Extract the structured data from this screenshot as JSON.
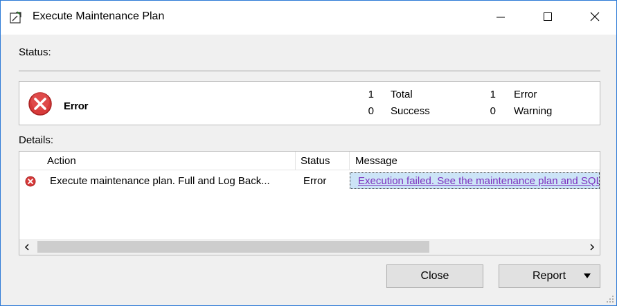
{
  "window": {
    "title": "Execute Maintenance Plan",
    "accent_color": "#2b79d6",
    "icons": [
      "maintenance-plan-icon",
      "minimize-icon",
      "maximize-icon",
      "close-icon"
    ]
  },
  "status": {
    "label": "Status:",
    "state": "Error",
    "state_icon": "error-icon",
    "error_color": "#d73a3a",
    "total_count": "1",
    "total_label": "Total",
    "success_count": "0",
    "success_label": "Success",
    "error_count": "1",
    "error_label": "Error",
    "warning_count": "0",
    "warning_label": "Warning"
  },
  "details": {
    "label": "Details:",
    "columns": [
      "Action",
      "Status",
      "Message"
    ],
    "rows": [
      {
        "icon": "error-icon",
        "action": "Execute maintenance plan. Full and Log Back...",
        "status": "Error",
        "message": "Execution failed. See the maintenance plan and SQL Server Agent job history logs for details."
      }
    ]
  },
  "buttons": {
    "close_label": "Close",
    "report_label": "Report"
  }
}
